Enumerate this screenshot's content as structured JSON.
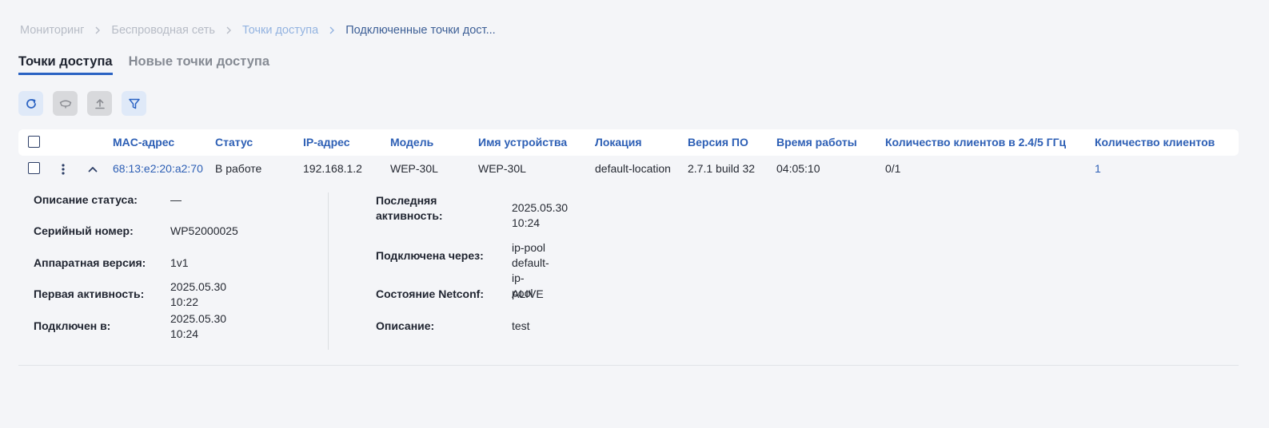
{
  "breadcrumb": {
    "items": [
      "Мониторинг",
      "Беспроводная сеть",
      "Точки доступа",
      "Подключенные точки дост..."
    ]
  },
  "tabs": {
    "access_points": "Точки доступа",
    "new_access_points": "Новые точки доступа"
  },
  "toolbar": {
    "refresh_icon": "refresh-icon",
    "reboot_icon": "router-icon",
    "upload_icon": "upload-icon",
    "filter_icon": "filter-icon"
  },
  "table": {
    "columns": {
      "mac": "MAC-адрес",
      "status": "Статус",
      "ip": "IP-адрес",
      "model": "Модель",
      "device_name": "Имя устройства",
      "location": "Локация",
      "firmware": "Версия ПО",
      "uptime": "Время работы",
      "clients_bands": "Количество клиентов в 2.4/5 ГГц",
      "clients": "Количество клиентов"
    },
    "row": {
      "mac": "68:13:e2:20:a2:70",
      "status": "В работе",
      "ip": "192.168.1.2",
      "model": "WEP-30L",
      "device_name": "WEP-30L",
      "location": "default-location",
      "firmware": "2.7.1 build 32",
      "uptime": "04:05:10",
      "clients_bands": "0/1",
      "clients": "1"
    }
  },
  "details": {
    "left": [
      {
        "label": "Описание статуса:",
        "value": "—"
      },
      {
        "label": "Серийный номер:",
        "value": "WP52000025"
      },
      {
        "label": "Аппаратная версия:",
        "value": "1v1"
      },
      {
        "label": "Первая активность:",
        "value": "2025.05.30 10:22"
      },
      {
        "label": "Подключен в:",
        "value": "2025.05.30 10:24"
      }
    ],
    "right": [
      {
        "label_line1": "Последняя",
        "label_line2": "активность:",
        "value": "2025.05.30 10:24"
      },
      {
        "label": "Подключена через:",
        "value_line1": "ip-pool default-ip-",
        "value_line2": "pool"
      },
      {
        "label": "Состояние Netconf:",
        "value": "ALIVE"
      },
      {
        "label": "Описание:",
        "value": "test"
      }
    ]
  },
  "colors": {
    "accent": "#2b63c3",
    "link": "#2d5fb5",
    "background": "#f4f5f8"
  }
}
